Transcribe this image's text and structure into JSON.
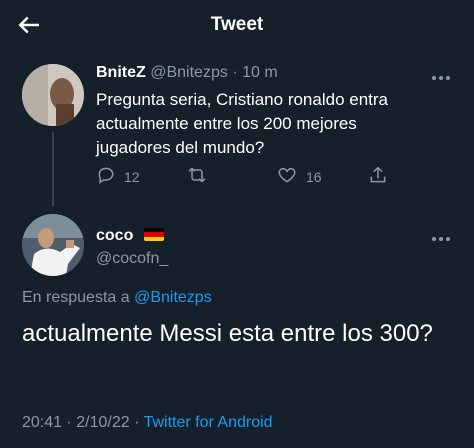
{
  "header": {
    "title": "Tweet"
  },
  "parent_tweet": {
    "author_name": "BniteZ",
    "handle": "@Bnitezps",
    "separator": "·",
    "time": "10 m",
    "text": "Pregunta seria, Cristiano ronaldo entra actualmente entre los 200 mejores jugadores del mundo?",
    "reply_count": "12",
    "like_count": "16"
  },
  "reply_tweet": {
    "author_name": "coco",
    "flag": "🇩🇪",
    "handle": "@cocofn_",
    "replying_prefix": "En respuesta a",
    "replying_handle": "@Bnitezps",
    "text": "actualmente Messi esta entre los 300?",
    "time": "20:41",
    "date_separator": "·",
    "date": "2/10/22",
    "source_separator": "·",
    "source": "Twitter for Android"
  },
  "colors": {
    "background": "#15202b",
    "text": "#ffffff",
    "muted": "#8b98a5",
    "link": "#1d9bf0",
    "divider": "#38444d"
  }
}
